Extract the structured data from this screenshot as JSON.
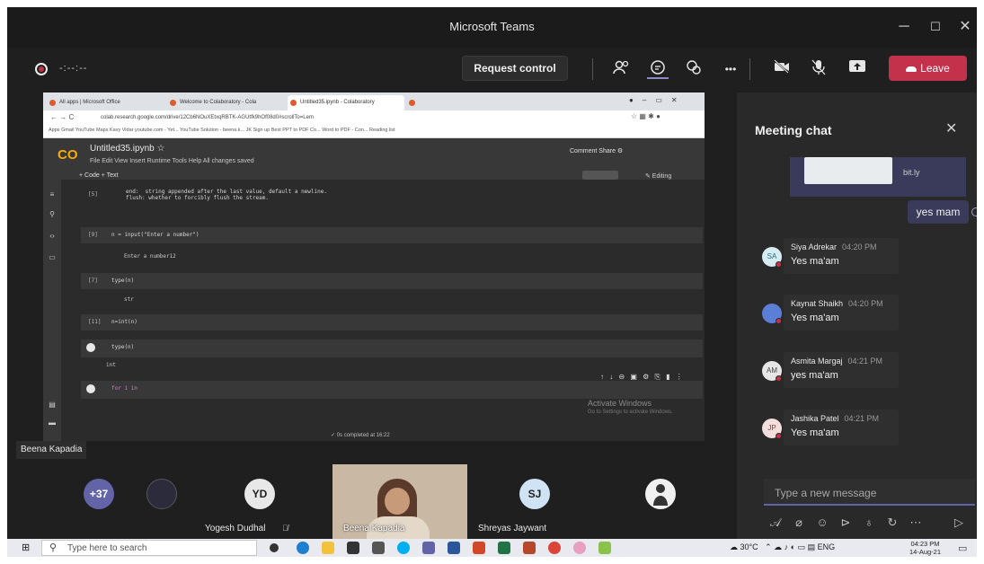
{
  "window": {
    "title": "Microsoft Teams",
    "minimize": "─",
    "maximize": "☐",
    "close": "✕"
  },
  "toolbar": {
    "timer": "-:--:--",
    "request_control": "Request control",
    "more": "•••",
    "leave": "Leave",
    "leave_color": "#c4314b"
  },
  "browser": {
    "tabs": [
      "All apps | Microsoft Office",
      "Welcome to Colaboratory - Cola",
      "Untitled35.ipynb - Colaboratory",
      "+"
    ],
    "url": "colab.research.google.com/drive/12Cb6NOuXEtxqRBTK-AGUtfk9hOf08d0#scrollTo=Lem",
    "bookmarks": "Apps   Gmail   YouTube   Maps   Kavy Vidar   youtube.com - Yet...   YouTube   Solution - beena.k...   JK Sign up   Best PPT to PDF Co...   Word to PDF - Con...   Reading list"
  },
  "colab": {
    "logo": "CO",
    "notebook_name": "Untitled35.ipynb  ☆",
    "menu": "File  Edit  View  Insert  Runtime  Tools  Help   All changes saved",
    "actions": "Comment    Share   ⚙",
    "code_bar": "+ Code   + Text",
    "editing": "✎ Editing",
    "cells": [
      {
        "num": "[5]",
        "src": "end:  string appended after the last value, default a newline.\nflush: whether to forcibly flush the stream."
      },
      {
        "num": "[9]",
        "src": "n = input(\"Enter a number\")",
        "out": "Enter a number12"
      },
      {
        "num": "[7]",
        "src": "type(n)",
        "out": "str"
      },
      {
        "num": "[11]",
        "src": "n=int(n)"
      },
      {
        "num": "",
        "src": "type(n)",
        "out": "int"
      },
      {
        "num": "",
        "src": "for i in"
      }
    ],
    "activate_title": "Activate Windows",
    "activate_sub": "Go to Settings to activate Windows.",
    "status": "✓ 0s   completed at 16:22"
  },
  "presenter_label": "Beena Kapadia",
  "chat": {
    "title": "Meeting chat",
    "bitly": "bit.ly",
    "my_message": "yes mam",
    "messages": [
      {
        "initials": "SA",
        "name": "Siya Adrekar",
        "time": "04:20 PM",
        "text": "Yes ma'am",
        "color": "#e1f0f5"
      },
      {
        "initials": "KS",
        "name": "Kaynat Shaikh",
        "time": "04:20 PM",
        "text": "Yes ma'am",
        "color": "#5b7fd6"
      },
      {
        "initials": "AM",
        "name": "Asmita Margaj",
        "time": "04:21 PM",
        "text": "yes ma'am",
        "color": "#eeeeee"
      },
      {
        "initials": "JP",
        "name": "Jashika Patel",
        "time": "04:21 PM",
        "text": "Yes ma'am",
        "color": "#f5e1e1"
      }
    ],
    "compose_placeholder": "Type a new message"
  },
  "participants": [
    {
      "initials": "+37",
      "name": "",
      "color": "#6264a7"
    },
    {
      "initials": "",
      "name": "",
      "color": "#2b2b3b"
    },
    {
      "initials": "YD",
      "name": "Yogesh Dudhal",
      "color": "#e8e8e8"
    },
    {
      "initials": "",
      "name": "Beena Kapadia",
      "color": ""
    },
    {
      "initials": "SJ",
      "name": "Shreyas Jaywant",
      "color": "#cfe3f5"
    },
    {
      "initials": "",
      "name": "",
      "color": "#f0f0f0"
    }
  ],
  "taskbar": {
    "search_placeholder": "Type here to search",
    "weather": "30°C",
    "tray": "ENG",
    "time": "04:23 PM",
    "date": "14-Aug-21"
  }
}
